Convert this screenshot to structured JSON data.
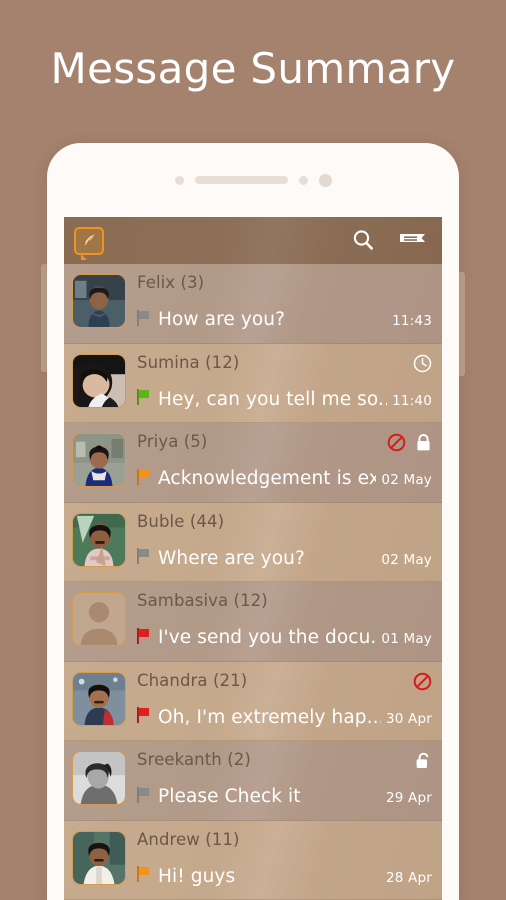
{
  "page": {
    "title": "Message Summary",
    "background_color": "#a4826d",
    "title_color": "#ffffff"
  },
  "phone": {
    "hardware": {
      "sensor_small_left": "sensor-dot",
      "speaker": "speaker-grille",
      "sensor_small_right": "sensor-dot",
      "camera": "front-camera"
    }
  },
  "app": {
    "header": {
      "logo_label": "quill-chat-logo",
      "logo_color": "#f0941e",
      "bar_color": "#8a6c53",
      "search_label": "Search",
      "menu_label": "Menu"
    },
    "flag_colors": {
      "none": "#8a8a8a",
      "green": "#5eb318",
      "orange": "#f0941e",
      "red": "#e02020"
    },
    "status_colors": {
      "block": "#d81b1b",
      "lock": "#ffffff",
      "clock": "#ffffff"
    },
    "messages": [
      {
        "sender": "Felix (3)",
        "preview": "How are you?",
        "time": "11:43",
        "flag": "none",
        "avatar": "photo-felix",
        "status": [],
        "tone": "tone-a"
      },
      {
        "sender": "Sumina (12)",
        "preview": "Hey, can you tell me so...",
        "time": "11:40",
        "flag": "green",
        "avatar": "photo-sumina",
        "status": [
          "clock"
        ],
        "tone": "tone-b"
      },
      {
        "sender": "Priya (5)",
        "preview": "Acknowledgement is ex...",
        "time": "02 May",
        "flag": "orange",
        "avatar": "photo-priya",
        "status": [
          "block",
          "lock-closed"
        ],
        "tone": "tone-a"
      },
      {
        "sender": "Buble (44)",
        "preview": "Where are you?",
        "time": "02 May",
        "flag": "none",
        "avatar": "photo-buble",
        "status": [],
        "tone": "tone-b"
      },
      {
        "sender": "Sambasiva (12)",
        "preview": "I've send you the docu...",
        "time": "01 May",
        "flag": "red",
        "avatar": "default-person",
        "status": [],
        "tone": "tone-a"
      },
      {
        "sender": "Chandra (21)",
        "preview": "Oh, I'm extremely hap...",
        "time": "30 Apr",
        "flag": "red",
        "avatar": "photo-chandra",
        "status": [
          "block"
        ],
        "tone": "tone-b"
      },
      {
        "sender": "Sreekanth (2)",
        "preview": "Please Check it",
        "time": "29 Apr",
        "flag": "none",
        "avatar": "photo-sreekanth",
        "status": [
          "lock-open"
        ],
        "tone": "tone-a"
      },
      {
        "sender": "Andrew (11)",
        "preview": "Hi! guys",
        "time": "28 Apr",
        "flag": "orange",
        "avatar": "photo-andrew",
        "status": [],
        "tone": "tone-b"
      }
    ]
  }
}
